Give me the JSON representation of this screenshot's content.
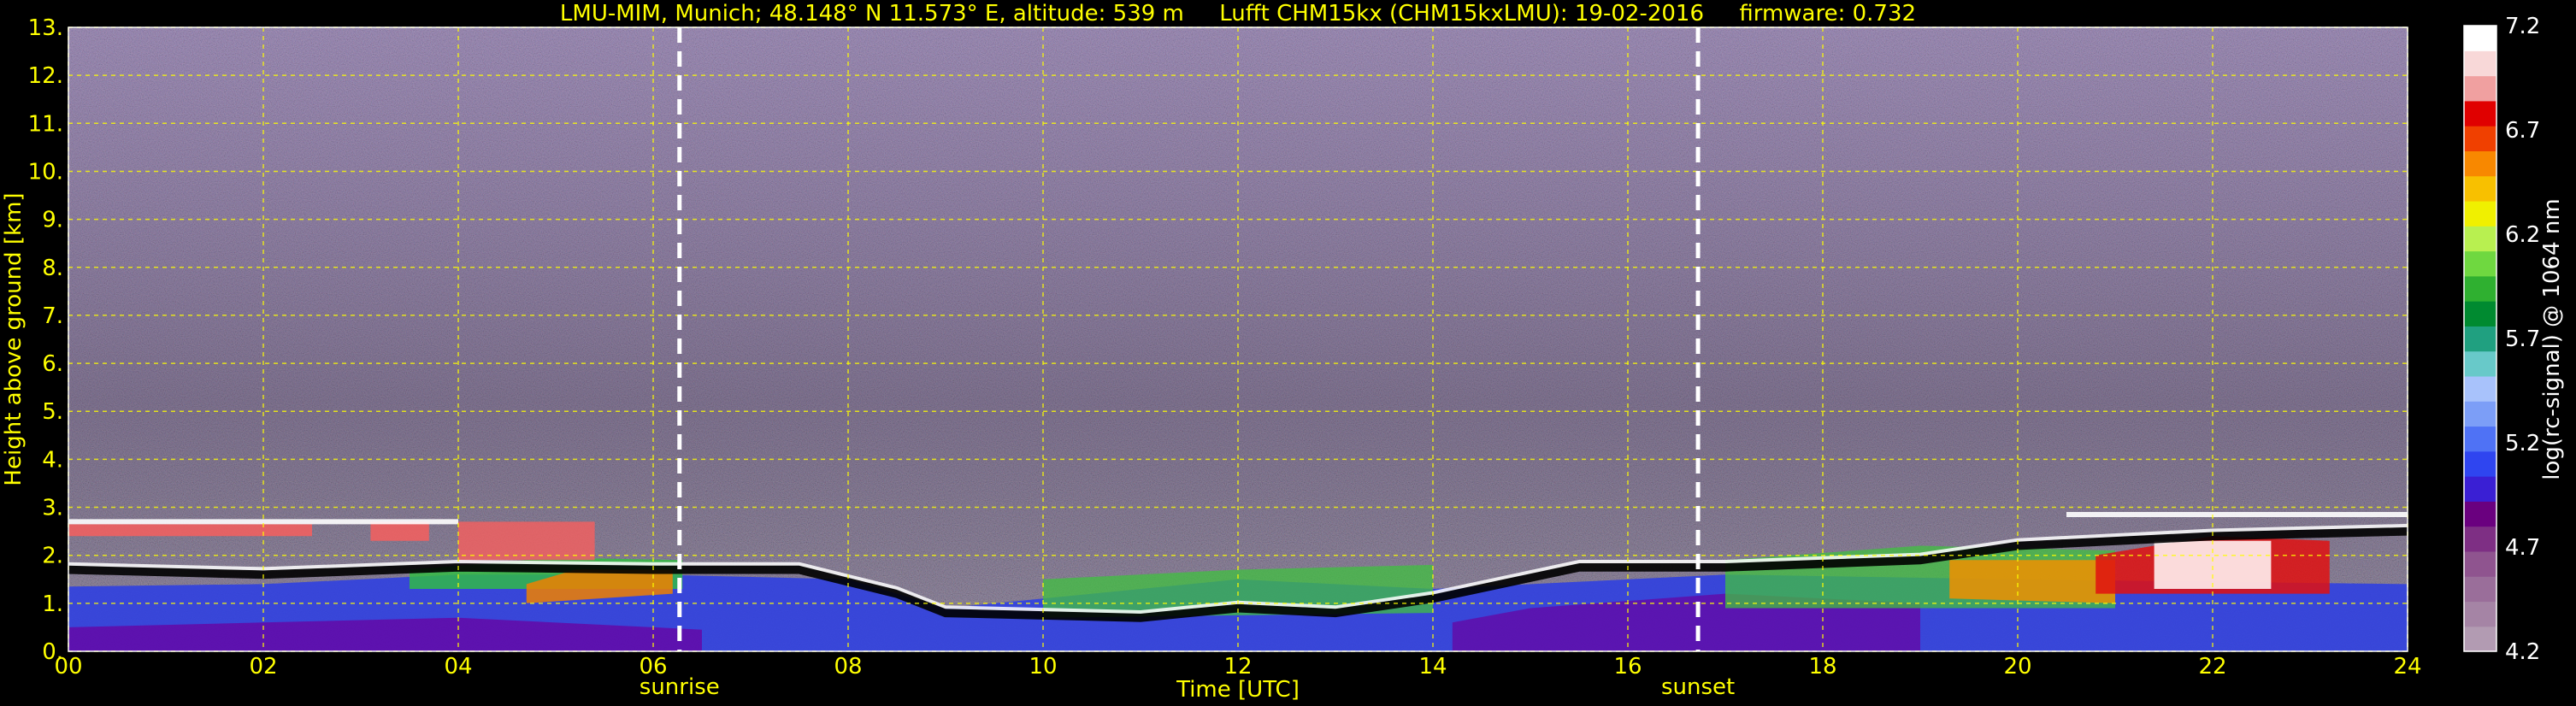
{
  "chart_data": {
    "type": "heatmap",
    "title": "LMU-MIM, Munich; 48.148° N 11.573° E, altitude: 539 m     Lufft CHM15kx (CHM15kxLMU): 19-02-2016     firmware: 0.732",
    "xlabel": "Time [UTC]",
    "ylabel": "Height above ground [km]",
    "xlim": [
      0,
      24
    ],
    "ylim": [
      0,
      13
    ],
    "x_ticks": [
      "00",
      "02",
      "04",
      "06",
      "08",
      "10",
      "12",
      "14",
      "16",
      "18",
      "20",
      "22",
      "24"
    ],
    "y_ticks": [
      "0.",
      "1.",
      "2.",
      "3.",
      "4.",
      "5.",
      "6.",
      "7.",
      "8.",
      "9.",
      "10.",
      "11.",
      "12.",
      "13."
    ],
    "grid": true,
    "markers": [
      {
        "label": "sunrise",
        "x": 6.27
      },
      {
        "label": "sunset",
        "x": 16.72
      }
    ],
    "colorbar": {
      "label": "log(rc-signal) @ 1064 nm",
      "min": 4.2,
      "max": 7.2,
      "ticks": [
        "4.2",
        "4.7",
        "5.2",
        "5.7",
        "6.2",
        "6.7",
        "7.2"
      ],
      "colors": [
        "#b29bb2",
        "#a584a5",
        "#9a6e9a",
        "#8f548f",
        "#7e2f84",
        "#6a007f",
        "#3a1fd4",
        "#2f45f0",
        "#4f72f5",
        "#7c9ef7",
        "#a8c2fb",
        "#68c9c9",
        "#20a080",
        "#008a30",
        "#2fb030",
        "#6fd840",
        "#b8f050",
        "#f0f000",
        "#f8c000",
        "#f88800",
        "#f04000",
        "#e00000",
        "#f0a0a0",
        "#f8d8d8",
        "#ffffff"
      ]
    }
  }
}
